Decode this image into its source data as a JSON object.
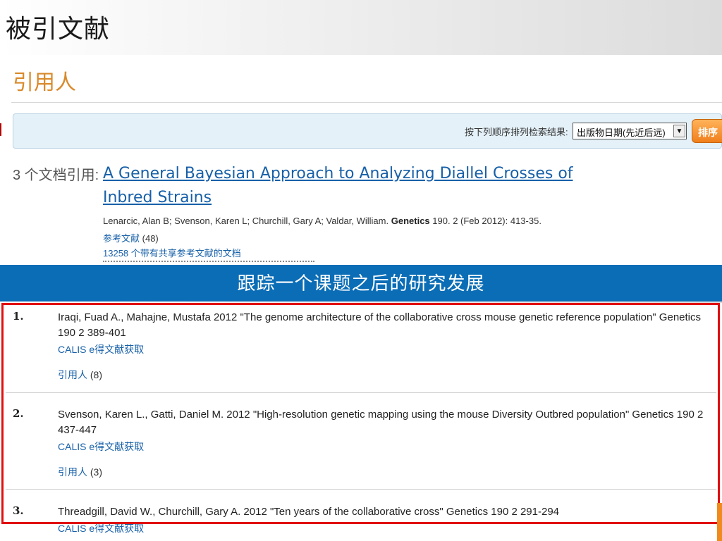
{
  "slide": {
    "title": "被引文献",
    "banner_text": "跟踪一个课题之后的研究发展",
    "colors": {
      "banner": "#0b6db6",
      "frame": "#e01010",
      "heading": "#d98a2b",
      "link": "#1760a8"
    }
  },
  "panel_top": {
    "section_heading": "引用人",
    "sort": {
      "label": "按下列顺序排列检索结果:",
      "selected_option": "出版物日期(先近后远)",
      "button_label": "排序"
    },
    "cited_count_label": "3 个文档引用:",
    "article": {
      "title": "A General Bayesian Approach to Analyzing Diallel Crosses of Inbred Strains",
      "authors": "Lenarcic, Alan B; Svenson, Karen L; Churchill, Gary A; Valdar, William.",
      "journal": "Genetics",
      "details": "190. 2  (Feb 2012): 413-35.",
      "references_label": "参考文献",
      "references_count": "(48)",
      "shared_refs_label": "13258 个带有共享参考文献的文档"
    }
  },
  "panel_bottom": {
    "items": [
      {
        "num": "1.",
        "text": "Iraqi, Fuad A., Mahajne, Mustafa 2012 \"The genome architecture of the collaborative cross mouse genetic reference population\" Genetics 190 2 389-401",
        "link_label": "CALIS e得文献获取",
        "cited_label": "引用人",
        "cited_count": "(8)"
      },
      {
        "num": "2.",
        "text": "Svenson, Karen L., Gatti, Daniel M. 2012 \"High-resolution genetic mapping using the mouse Diversity Outbred population\" Genetics 190 2 437-447",
        "link_label": "CALIS e得文献获取",
        "cited_label": "引用人",
        "cited_count": "(3)"
      },
      {
        "num": "3.",
        "text": "Threadgill, David W., Churchill, Gary A. 2012 \"Ten years of the collaborative cross\" Genetics 190 2 291-294",
        "link_label": "CALIS e得文献获取"
      }
    ]
  }
}
